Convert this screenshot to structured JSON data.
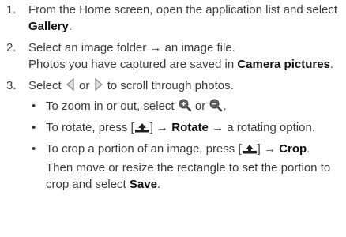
{
  "steps": [
    {
      "number": "1.",
      "text_a": "From the Home screen, open the application list and select ",
      "bold_a": "Gallery",
      "text_b": "."
    },
    {
      "number": "2.",
      "text_a": "Select an image folder → an image file.",
      "sub_a": "Photos you have captured are saved in ",
      "sub_bold": "Camera pictures",
      "sub_b": "."
    },
    {
      "number": "3.",
      "text_a": "Select ",
      "text_or": " or ",
      "text_b": " to scroll through photos.",
      "bullets": {
        "zoom": {
          "text_a": "To zoom in or out, select ",
          "text_or": " or ",
          "text_b": "."
        },
        "rotate": {
          "text_a": "To rotate, press [",
          "text_b": "] → ",
          "bold": "Rotate",
          "text_c": " → a rotating option."
        },
        "crop": {
          "text_a": "To crop a portion of an image, press [",
          "text_b": "] → ",
          "bold_a": "Crop",
          "text_c": ". Then move or resize the rectangle to set the portion to crop and select ",
          "bold_b": "Save",
          "text_d": "."
        }
      }
    }
  ],
  "icons": {
    "scroll_left": "arrow-left-icon",
    "scroll_right": "arrow-right-icon",
    "zoom_in": "zoom-in-icon",
    "zoom_out": "zoom-out-icon",
    "menu": "menu-key-icon"
  },
  "colors": {
    "text": "#3c3c3c",
    "bold": "#111111"
  }
}
